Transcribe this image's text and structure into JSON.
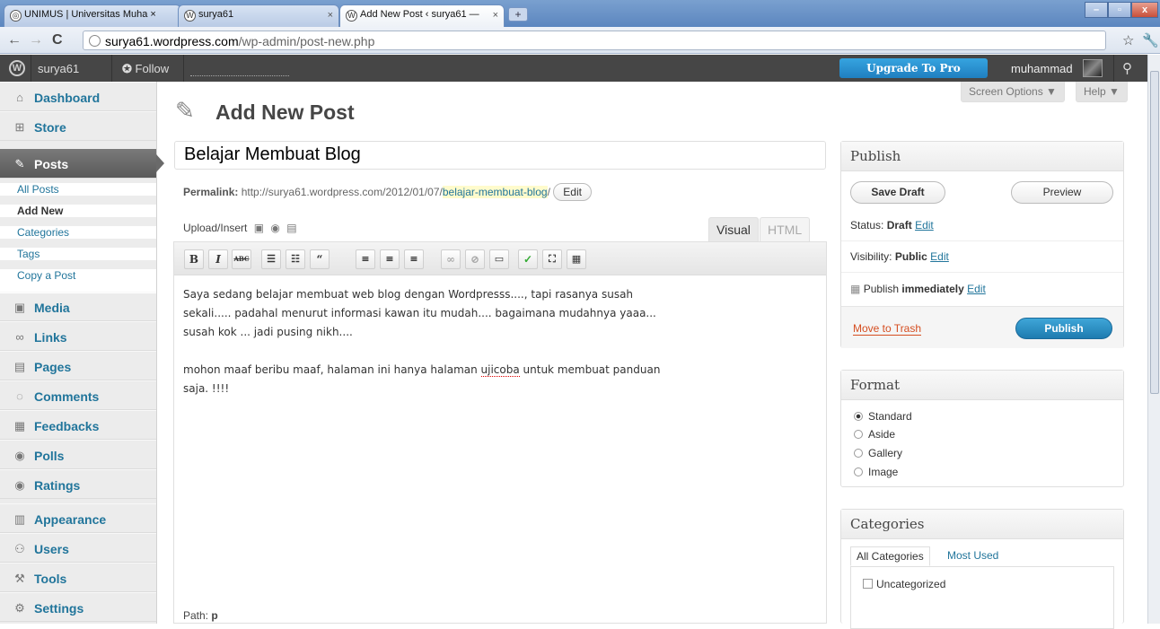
{
  "browser": {
    "tabs": [
      {
        "label": "UNIMUS | Universitas Muha ×",
        "close": ""
      },
      {
        "label": "surya61",
        "close": "×"
      },
      {
        "label": "Add New Post ‹ surya61 —",
        "close": "×"
      }
    ],
    "url_host": "surya61.wordpress.com",
    "url_path": "/wp-admin/post-new.php"
  },
  "adminbar": {
    "site": "surya61",
    "follow": "Follow",
    "upgrade": "Upgrade To Pro",
    "user": "muhammad"
  },
  "sidebar": {
    "dashboard": "Dashboard",
    "store": "Store",
    "posts": "Posts",
    "posts_sub": [
      "All Posts",
      "Add New",
      "Categories",
      "Tags",
      "Copy a Post"
    ],
    "media": "Media",
    "links": "Links",
    "pages": "Pages",
    "comments": "Comments",
    "feedbacks": "Feedbacks",
    "polls": "Polls",
    "ratings": "Ratings",
    "appearance": "Appearance",
    "users": "Users",
    "tools": "Tools",
    "settings": "Settings"
  },
  "header": {
    "title": "Add New Post",
    "screen_options": "Screen Options ▼",
    "help": "Help ▼"
  },
  "post": {
    "title": "Belajar Membuat Blog",
    "permalink_label": "Permalink:",
    "permalink_base": "http://surya61.wordpress.com/2012/01/07/",
    "permalink_slug": "belajar-membuat-blog",
    "permalink_end": "/",
    "edit": "Edit",
    "upload_insert": "Upload/Insert",
    "tab_visual": "Visual",
    "tab_html": "HTML",
    "content_p1_l1": "Saya sedang belajar membuat web blog dengan Wordpresss...., tapi rasanya susah",
    "content_p1_l2": "sekali..... padahal menurut informasi kawan itu mudah.... bagaimana mudahnya yaaa...",
    "content_p1_l3": "susah kok ... jadi pusing nikh....",
    "content_p2_a": "mohon maaf beribu maaf,  halaman ini hanya halaman ",
    "content_p2_spell": "ujicoba",
    "content_p2_b": " untuk membuat panduan",
    "content_p2_l2": "saja. !!!!",
    "path_label": "Path:",
    "path_value": "p"
  },
  "publish": {
    "title": "Publish",
    "save_draft": "Save Draft",
    "preview": "Preview",
    "status_label": "Status:",
    "status_value": "Draft",
    "visibility_label": "Visibility:",
    "visibility_value": "Public",
    "publish_label": "Publish",
    "publish_value": "immediately",
    "edit": "Edit",
    "trash": "Move to Trash",
    "publish_button": "Publish"
  },
  "format": {
    "title": "Format",
    "options": [
      "Standard",
      "Aside",
      "Gallery",
      "Image"
    ],
    "selected": "Standard"
  },
  "categories": {
    "title": "Categories",
    "tab_all": "All Categories",
    "tab_most": "Most Used",
    "items": [
      "Uncategorized"
    ]
  },
  "colors": {
    "link": "#21759b",
    "adminbar": "#464646",
    "primary_button": "#2a95c5"
  }
}
